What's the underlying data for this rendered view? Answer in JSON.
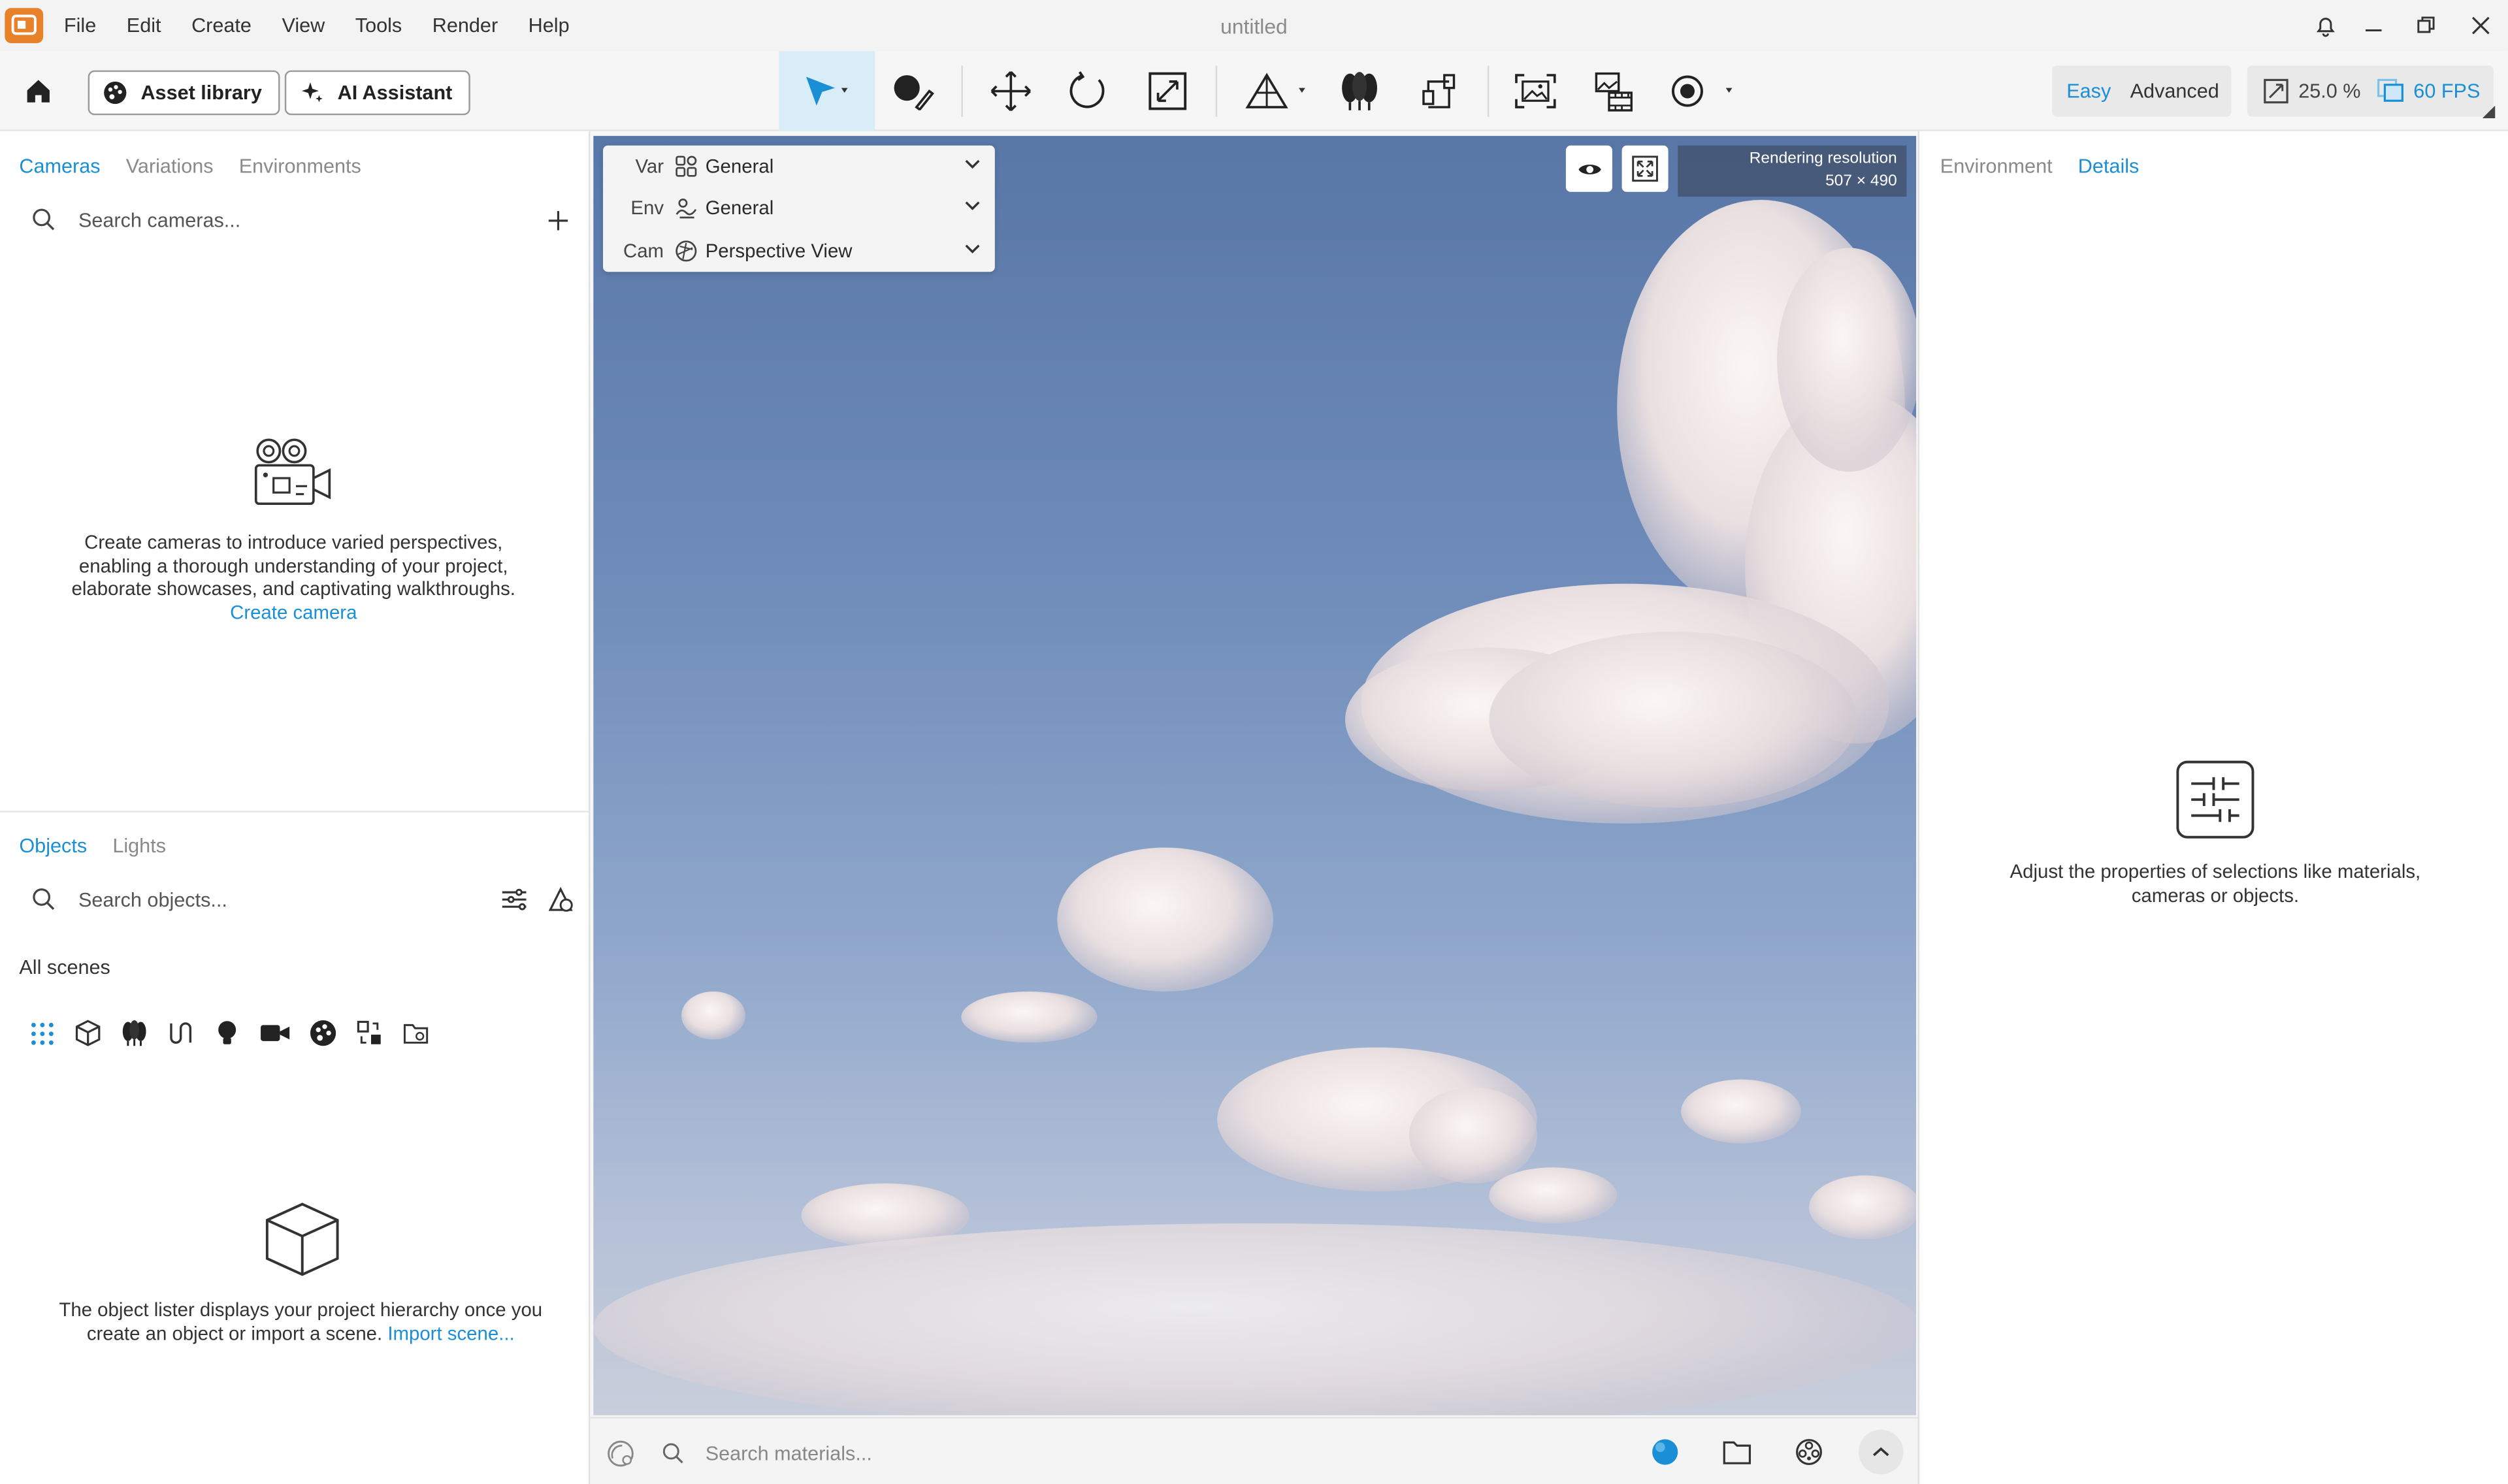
{
  "window": {
    "title": "untitled",
    "menu": [
      "File",
      "Edit",
      "Create",
      "View",
      "Tools",
      "Render",
      "Help"
    ]
  },
  "toolbar": {
    "asset_library_label": "Asset library",
    "ai_assistant_label": "AI Assistant",
    "mode_easy": "Easy",
    "mode_advanced": "Advanced",
    "resolution_scale": "25.0 %",
    "fps": "60 FPS",
    "tools": [
      "select-icon",
      "paint-material-icon",
      "move-icon",
      "rotate-icon",
      "scale-icon",
      "snap-icon",
      "vegetation-icon",
      "animation-icon",
      "render-image-icon",
      "render-video-icon",
      "record-icon"
    ]
  },
  "left_panel": {
    "camera_tabs": [
      "Cameras",
      "Variations",
      "Environments"
    ],
    "active_camera_tab": "Cameras",
    "camera_search_placeholder": "Search cameras...",
    "camera_empty_text": "Create cameras to introduce varied perspectives, enabling a thorough understanding of your project, elaborate showcases, and captivating walkthroughs.",
    "create_camera_link": "Create camera",
    "object_tabs": [
      "Objects",
      "Lights"
    ],
    "active_object_tab": "Objects",
    "object_search_placeholder": "Search objects...",
    "scene_filter_label": "All scenes",
    "filter_icons": [
      "grid-icon",
      "cube-icon",
      "vegetation-icon",
      "path-icon",
      "light-bulb-icon",
      "camera-icon",
      "material-icon",
      "swap-icon",
      "folder-icon"
    ],
    "object_empty_text": "The object lister displays your project hierarchy once you create an object or import a scene.",
    "import_scene_link": "Import scene..."
  },
  "viewport": {
    "dropdowns": [
      {
        "key": "Var",
        "icon": "variations-icon",
        "value": "General"
      },
      {
        "key": "Env",
        "icon": "environment-icon",
        "value": "General"
      },
      {
        "key": "Cam",
        "icon": "camera-view-icon",
        "value": "Perspective View"
      }
    ],
    "rendering_label": "Rendering resolution",
    "rendering_value": "507 × 490"
  },
  "right_panel": {
    "tabs": [
      "Environment",
      "Details"
    ],
    "active_tab": "Details",
    "empty_text": "Adjust the properties of selections like materials, cameras or objects."
  },
  "bottom_bar": {
    "material_search_placeholder": "Search materials..."
  },
  "colors": {
    "accent": "#1b8fd6",
    "active_tool_bg": "#d8edf8",
    "logo": "#e8822a"
  }
}
